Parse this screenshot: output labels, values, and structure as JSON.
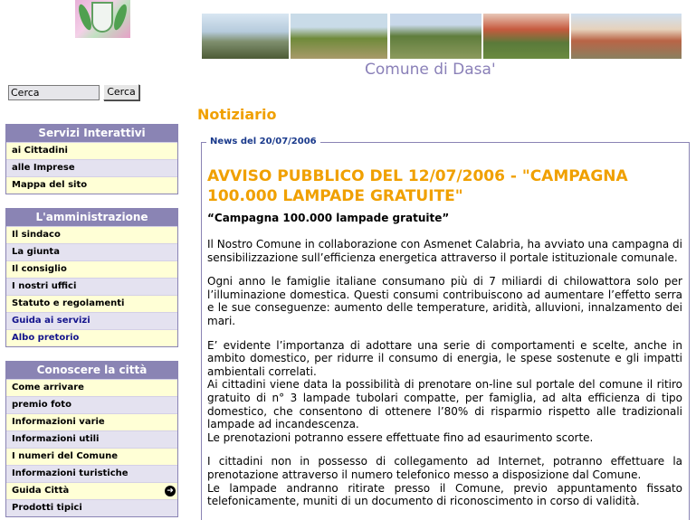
{
  "site": {
    "title": "Comune di Dasa'"
  },
  "search": {
    "value": "Cerca",
    "button": "Cerca"
  },
  "menus": [
    {
      "header": "Servizi Interattivi",
      "items": [
        "ai Cittadini",
        "alle Imprese",
        "Mappa del sito"
      ]
    },
    {
      "header": "L'amministrazione",
      "items": [
        "Il sindaco",
        "La giunta",
        "Il consiglio",
        "I nostri uffici",
        "Statuto e regolamenti",
        "Guida ai servizi",
        "Albo pretorio"
      ]
    },
    {
      "header": "Conoscere la città",
      "items": [
        "Come arrivare",
        "premio foto",
        "Informazioni varie",
        "Informazioni utili",
        "I numeri del Comune",
        "Informazioni turistiche",
        "Guida Città",
        "Prodotti tipici"
      ]
    }
  ],
  "main": {
    "heading": "Notiziario",
    "news": {
      "legend": "News del 20/07/2006",
      "title": "AVVISO PUBBLICO DEL 12/07/2006 - \"CAMPAGNA 100.000 LAMPADE GRATUITE\"",
      "subtitle": "“Campagna 100.000 lampade gratuite”",
      "paragraphs": [
        "Il Nostro Comune in collaborazione con Asmenet Calabria, ha avviato una campagna di sensibilizzazione sull’efficienza energetica attraverso il portale istituzionale comunale.",
        "Ogni anno le famiglie italiane consumano più di 7 miliardi di chilowattora solo per l’illuminazione domestica. Questi consumi contribuiscono ad aumentare l’effetto serra e le sue conseguenze: aumento delle temperature, aridità, alluvioni, innalzamento dei mari.",
        "E’ evidente l’importanza di adottare una serie di comportamenti e scelte, anche in ambito domestico, per ridurre il consumo di energia, le spese sostenute e gli impatti ambientali correlati.",
        "Ai cittadini viene data la possibilità di prenotare on-line sul portale del comune il ritiro gratuito di n° 3 lampade tubolari compatte, per famiglia, ad alta efficienza di tipo domestico, che consentono di ottenere l’80% di risparmio rispetto alle tradizionali lampade ad incandescenza.",
        "Le prenotazioni potranno essere effettuate fino ad esaurimento scorte.",
        "I cittadini non in possesso di collegamento ad Internet, potranno effettuare la prenotazione attraverso il numero telefonico messo a disposizione dal Comune.",
        "Le lampade andranno ritirate presso il Comune, previo appuntamento fissato telefonicamente, muniti di un documento di riconoscimento in corso di validità."
      ]
    }
  }
}
